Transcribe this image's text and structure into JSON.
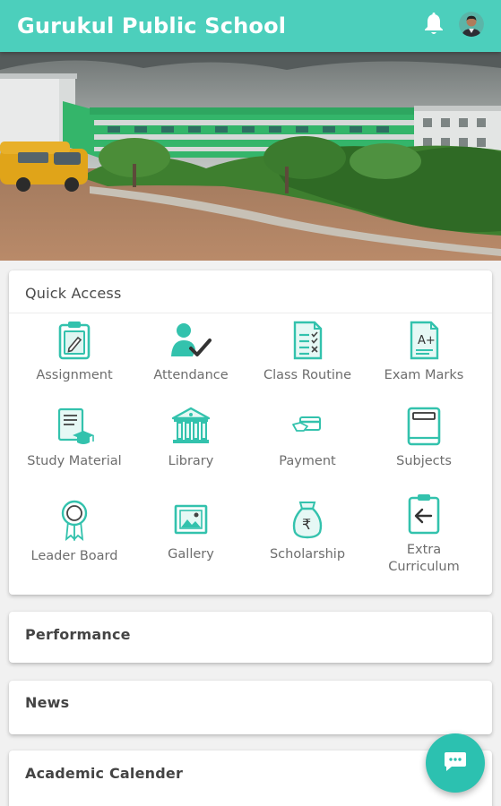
{
  "app": {
    "title": "Gurukul Public School"
  },
  "header": {
    "notification_icon": "bell-icon",
    "profile_icon": "avatar"
  },
  "colors": {
    "primary": "#4ccfbc",
    "icon_teal": "#33c2ad",
    "fab": "#2cc1b0"
  },
  "quick_access": {
    "title": "Quick Access",
    "items": [
      {
        "label": "Assignment",
        "icon": "clipboard-pencil-icon"
      },
      {
        "label": "Attendance",
        "icon": "person-check-icon"
      },
      {
        "label": "Class Routine",
        "icon": "checklist-document-icon"
      },
      {
        "label": "Exam Marks",
        "icon": "grade-document-icon"
      },
      {
        "label": "Study Material",
        "icon": "document-graduation-cap-icon"
      },
      {
        "label": "Library",
        "icon": "library-building-icon"
      },
      {
        "label": "Payment",
        "icon": "card-payment-icon"
      },
      {
        "label": "Subjects",
        "icon": "book-icon"
      },
      {
        "label": "Leader Board",
        "icon": "award-ribbon-icon"
      },
      {
        "label": "Gallery",
        "icon": "picture-icon"
      },
      {
        "label": "Scholarship",
        "icon": "rupee-bag-icon"
      },
      {
        "label": "Extra Curriculum",
        "icon": "clipboard-arrow-icon"
      }
    ]
  },
  "sections": [
    {
      "title": "Performance"
    },
    {
      "title": "News"
    },
    {
      "title": "Academic Calender"
    }
  ],
  "fab": {
    "icon": "chat-icon"
  }
}
